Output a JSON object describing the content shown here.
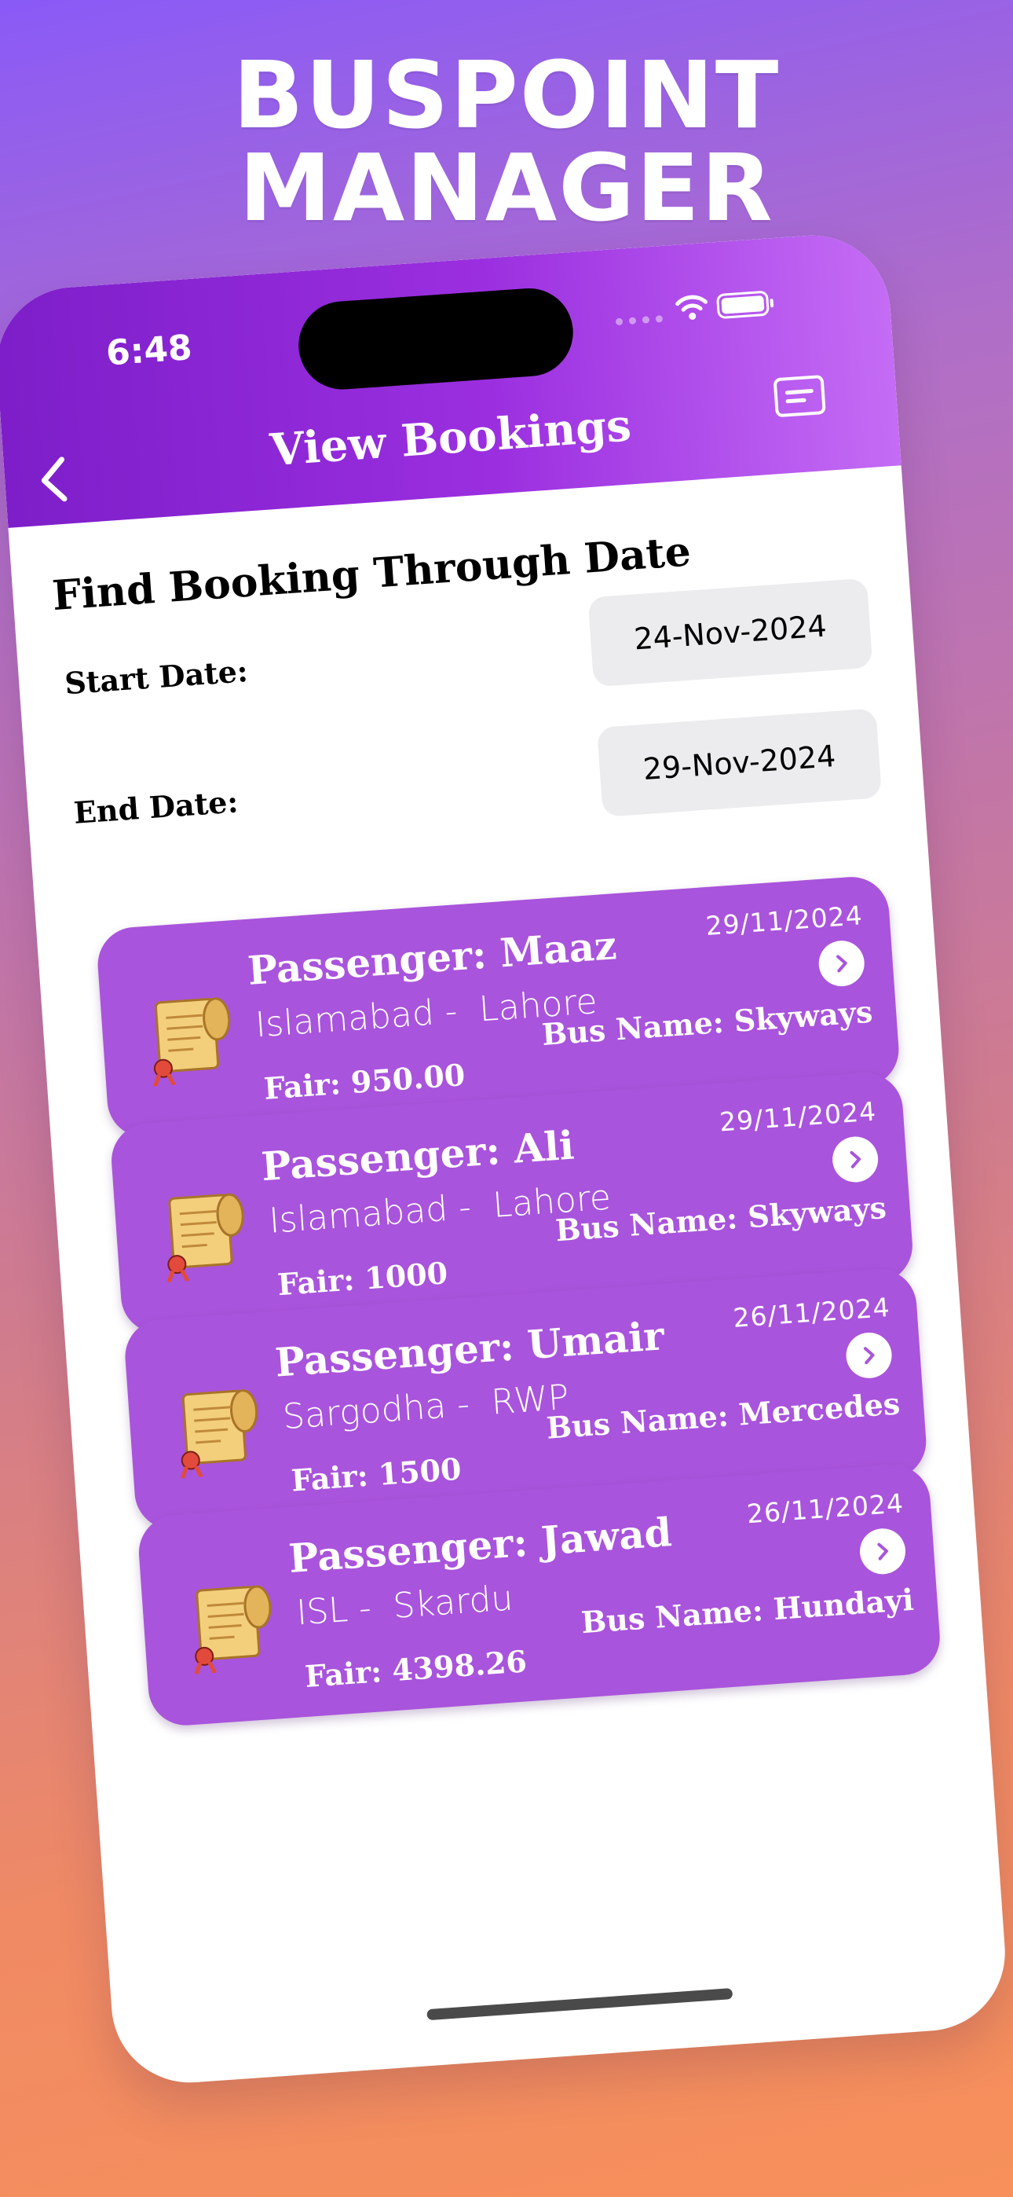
{
  "banner": {
    "title": "BUSPOINT MANAGER"
  },
  "status_bar": {
    "time": "6:48"
  },
  "nav": {
    "title": "View Bookings"
  },
  "filter": {
    "heading": "Find Booking Through Date",
    "start_label": "Start Date:",
    "start_value": "24-Nov-2024",
    "end_label": "End Date:",
    "end_value": "29-Nov-2024"
  },
  "bookings": [
    {
      "passenger": "Passenger: Maaz",
      "date": "29/11/2024",
      "from": "Islamabad",
      "to": "Lahore",
      "fair": "Fair: 950.00",
      "bus": "Bus Name: Skyways"
    },
    {
      "passenger": "Passenger: Ali",
      "date": "29/11/2024",
      "from": "Islamabad",
      "to": "Lahore",
      "fair": "Fair: 1000",
      "bus": "Bus Name: Skyways"
    },
    {
      "passenger": "Passenger: Umair",
      "date": "26/11/2024",
      "from": "Sargodha",
      "to": "RWP",
      "fair": "Fair: 1500",
      "bus": "Bus Name: Mercedes"
    },
    {
      "passenger": "Passenger: Jawad",
      "date": "26/11/2024",
      "from": "ISL",
      "to": "Skardu",
      "fair": "Fair: 4398.26",
      "bus": "Bus Name: Hundayi"
    }
  ],
  "colors": {
    "header_start": "#7d1ec9",
    "header_end": "#c46cf5",
    "card": "#a954dc"
  },
  "icons": [
    "back-chevron-icon",
    "id-card-icon",
    "wifi-icon",
    "battery-icon",
    "scroll-icon",
    "chevron-right-icon"
  ]
}
